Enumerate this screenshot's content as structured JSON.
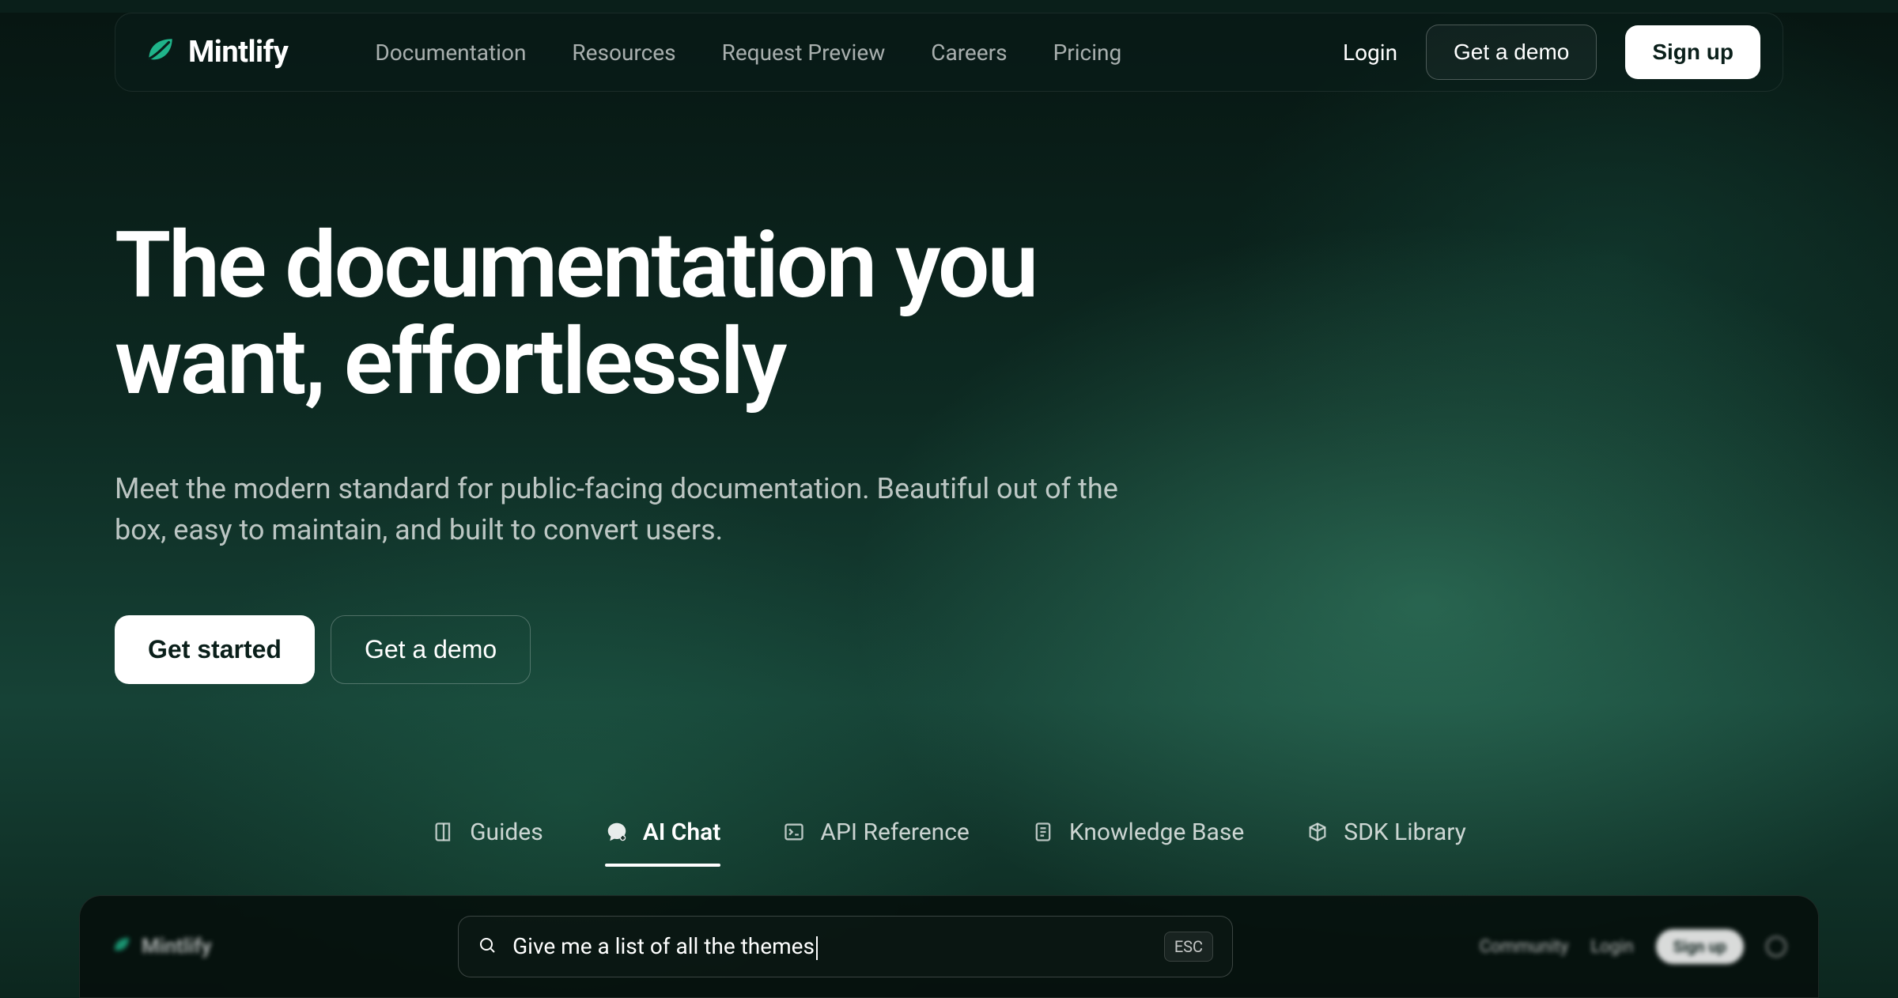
{
  "brand": "Mintlify",
  "nav": {
    "links": [
      "Documentation",
      "Resources",
      "Request Preview",
      "Careers",
      "Pricing"
    ],
    "login": "Login",
    "demo": "Get a demo",
    "signup": "Sign up"
  },
  "hero": {
    "title": "The documentation you want, effortlessly",
    "subtitle": "Meet the modern standard for public-facing documentation. Beautiful out of the box, easy to maintain, and built to convert users.",
    "primary": "Get started",
    "secondary": "Get a demo"
  },
  "tabs": [
    {
      "label": "Guides",
      "icon": "book-icon"
    },
    {
      "label": "AI Chat",
      "icon": "chat-icon"
    },
    {
      "label": "API Reference",
      "icon": "terminal-icon"
    },
    {
      "label": "Knowledge Base",
      "icon": "document-icon"
    },
    {
      "label": "SDK Library",
      "icon": "package-icon"
    }
  ],
  "active_tab": 1,
  "preview": {
    "brand": "Mintlify",
    "search_value": "Give me a list of all the themes",
    "esc": "ESC",
    "right_links": [
      "Community",
      "Login"
    ],
    "signup": "Sign up"
  }
}
